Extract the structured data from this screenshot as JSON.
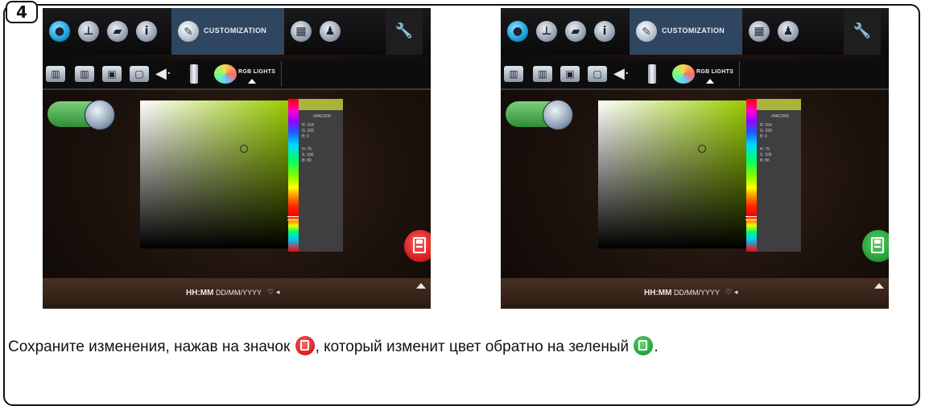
{
  "step_number": "4",
  "screens": [
    {
      "id": "before",
      "topbar": {
        "custom_tab_label": "CUSTOMIZATION"
      },
      "subbar": {
        "rgb_tab_label": "RGB LIGHTS"
      },
      "info": {
        "hex": "#9ACD00",
        "rgb": [
          "R: 154",
          "G: 205",
          "B: 0"
        ],
        "hsb": [
          "H: 75",
          "S: 100",
          "B: 80"
        ]
      },
      "datetime": {
        "time": "HH:MM",
        "date": "DD/MM/YYYY"
      },
      "save_state": "red"
    },
    {
      "id": "after",
      "topbar": {
        "custom_tab_label": "CUSTOMIZATION"
      },
      "subbar": {
        "rgb_tab_label": "RGB LIGHTS"
      },
      "info": {
        "hex": "#9ACD00",
        "rgb": [
          "R: 154",
          "G: 205",
          "B: 0"
        ],
        "hsb": [
          "H: 75",
          "S: 100",
          "B: 80"
        ]
      },
      "datetime": {
        "time": "HH:MM",
        "date": "DD/MM/YYYY"
      },
      "save_state": "green"
    }
  ],
  "caption": {
    "part1": "Сохраните изменения, нажав на значок ",
    "part2": ", который изменит цвет обратно на зеленый ",
    "part3": "."
  },
  "colors": {
    "save_red": "#d01818",
    "save_green": "#1f9a30",
    "tab_active": "#2e4660",
    "picker_hue": "#9acd00"
  }
}
